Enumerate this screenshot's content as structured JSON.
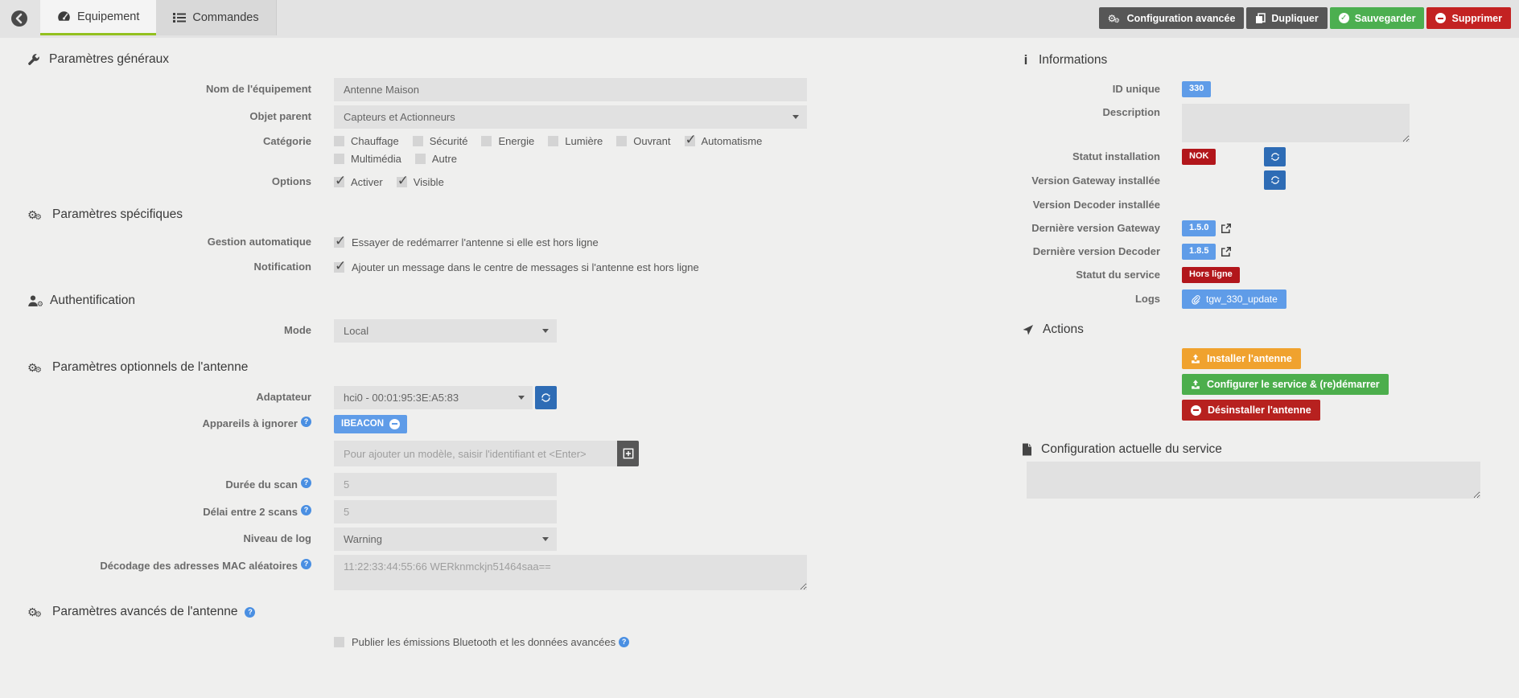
{
  "colors": {
    "accent_blue": "#5f9ce8",
    "dark_blue": "#2e6cb5",
    "success_green": "#4caf50",
    "danger_red": "#b2161b",
    "warning_orange": "#f0a22e",
    "tab_underline_green": "#93c01f"
  },
  "topbar": {
    "tabs": [
      {
        "label": "Equipement",
        "icon": "dashboard-icon",
        "active": true
      },
      {
        "label": "Commandes",
        "icon": "list-icon",
        "active": false
      }
    ],
    "advanced_label": "Configuration avancée",
    "duplicate_label": "Dupliquer",
    "save_label": "Sauvegarder",
    "delete_label": "Supprimer"
  },
  "general": {
    "title": "Paramètres généraux",
    "name_label": "Nom de l'équipement",
    "name_value": "Antenne Maison",
    "parent_label": "Objet parent",
    "parent_value": "Capteurs et Actionneurs",
    "category_label": "Catégorie",
    "categories": [
      {
        "label": "Chauffage",
        "checked": false
      },
      {
        "label": "Sécurité",
        "checked": false
      },
      {
        "label": "Energie",
        "checked": false
      },
      {
        "label": "Lumière",
        "checked": false
      },
      {
        "label": "Ouvrant",
        "checked": false
      },
      {
        "label": "Automatisme",
        "checked": true
      },
      {
        "label": "Multimédia",
        "checked": false
      },
      {
        "label": "Autre",
        "checked": false
      }
    ],
    "options_label": "Options",
    "options": [
      {
        "label": "Activer",
        "checked": true
      },
      {
        "label": "Visible",
        "checked": true
      }
    ]
  },
  "specific": {
    "title": "Paramètres spécifiques",
    "auto_label": "Gestion automatique",
    "auto_text": "Essayer de redémarrer l'antenne si elle est hors ligne",
    "auto_checked": true,
    "notif_label": "Notification",
    "notif_text": "Ajouter un message dans le centre de messages si l'antenne est hors ligne",
    "notif_checked": true
  },
  "auth": {
    "title": "Authentification",
    "mode_label": "Mode",
    "mode_value": "Local"
  },
  "optional": {
    "title": "Paramètres optionnels de l'antenne",
    "adapter_label": "Adaptateur",
    "adapter_value": "hci0 - 00:01:95:3E:A5:83",
    "ignore_label": "Appareils à ignorer",
    "ignore_tag": "IBEACON",
    "add_placeholder": "Pour ajouter un modèle, saisir l'identifiant et <Enter>",
    "scan_duration_label": "Durée du scan",
    "scan_duration_value": "5",
    "scan_delay_label": "Délai entre 2 scans",
    "scan_delay_value": "5",
    "log_level_label": "Niveau de log",
    "log_level_value": "Warning",
    "mac_label": "Décodage des adresses MAC aléatoires",
    "mac_placeholder": "11:22:33:44:55:66 WERknmckjn51464saa=="
  },
  "advanced": {
    "title": "Paramètres avancés de l'antenne",
    "publish_text": "Publier les émissions Bluetooth et les données avancées",
    "publish_checked": false
  },
  "info": {
    "title": "Informations",
    "id_label": "ID unique",
    "id_value": "330",
    "description_label": "Description",
    "install_status_label": "Statut installation",
    "install_status_value": "NOK",
    "gateway_installed_label": "Version Gateway installée",
    "decoder_installed_label": "Version Decoder installée",
    "gateway_latest_label": "Dernière version Gateway",
    "gateway_latest_value": "1.5.0",
    "decoder_latest_label": "Dernière version Decoder",
    "decoder_latest_value": "1.8.5",
    "service_status_label": "Statut du service",
    "service_status_value": "Hors ligne",
    "logs_label": "Logs",
    "logs_value": "tgw_330_update"
  },
  "actions": {
    "title": "Actions",
    "install_label": "Installer l'antenne",
    "configure_label": "Configurer le service & (re)démarrer",
    "uninstall_label": "Désinstaller l'antenne"
  },
  "service_config": {
    "title": "Configuration actuelle du service"
  }
}
